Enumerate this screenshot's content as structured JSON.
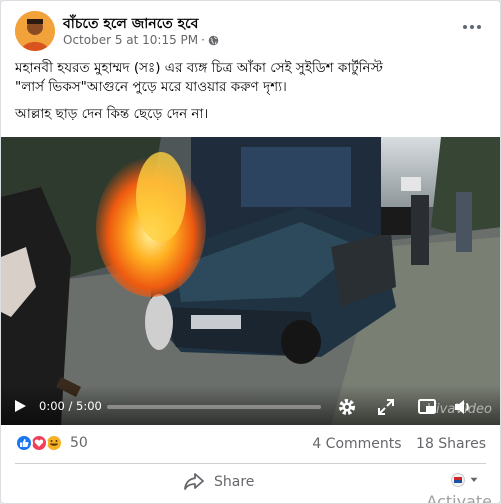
{
  "post": {
    "page_name": "বাঁচতে হলে জানতে হবে",
    "timestamp": "October 5 at 10:15 PM",
    "audience_icon": "globe-icon",
    "text_line1": "মহানবী হযরত মুহাম্মদ (সঃ) এর ব্যঙ্গ চিত্র আঁকা  সেই সুইডিশ কার্টুনিস্ট",
    "text_line2": "\"লার্স ভিকস\"আগুনে পুড়ে মরে যাওয়ার করুণ দৃশ্য।",
    "text_line3": "আল্লাহ ছাড় দেন কিন্ত ছেড়ে দেন না।"
  },
  "video": {
    "time": "0:00 / 5:00",
    "progress": 0.0,
    "watermark": "VivaVideo",
    "icons": [
      "play-icon",
      "settings-icon",
      "fullscreen-expand-icon",
      "picture-in-picture-icon",
      "volume-icon"
    ]
  },
  "stats": {
    "reaction_icons": [
      "like-icon",
      "love-icon",
      "haha-icon"
    ],
    "reaction_count": "50",
    "comments": "4 Comments",
    "shares": "18 Shares"
  },
  "actions": {
    "share_label": "Share",
    "activate_text": "Activate"
  },
  "colors": {
    "like_blue": "#1877f2",
    "love_red": "#f33e58",
    "haha_yellow": "#f7b125",
    "secondary_text": "#65676b"
  }
}
